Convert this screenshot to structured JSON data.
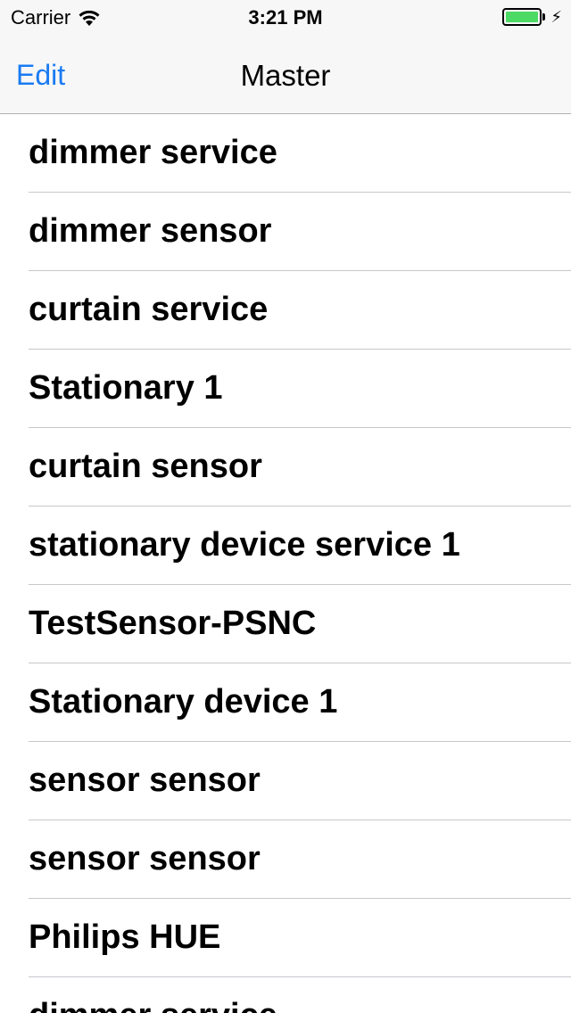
{
  "status_bar": {
    "carrier": "Carrier",
    "time": "3:21 PM",
    "battery_level": 1.0,
    "battery_color": "#4cd964",
    "charging_icon": "bolt-icon"
  },
  "nav_bar": {
    "edit_label": "Edit",
    "title": "Master",
    "accent_color": "#1a7bf2"
  },
  "table": {
    "rows": [
      {
        "label": "dimmer service"
      },
      {
        "label": "dimmer sensor"
      },
      {
        "label": "curtain service"
      },
      {
        "label": "Stationary 1"
      },
      {
        "label": "curtain sensor"
      },
      {
        "label": "stationary device service 1"
      },
      {
        "label": "TestSensor-PSNC"
      },
      {
        "label": "Stationary device 1"
      },
      {
        "label": "sensor sensor"
      },
      {
        "label": "sensor sensor"
      },
      {
        "label": "Philips HUE"
      },
      {
        "label": "dimmer service"
      }
    ]
  }
}
